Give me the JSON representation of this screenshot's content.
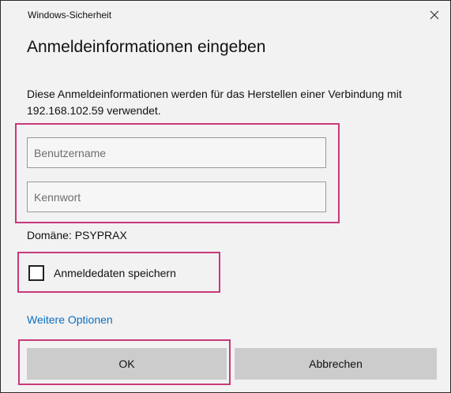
{
  "window": {
    "title": "Windows-Sicherheit"
  },
  "dialog": {
    "heading": "Anmeldeinformationen eingeben",
    "description": "Diese Anmeldeinformationen werden für das Herstellen einer Verbindung mit 192.168.102.59 verwendet.",
    "username": {
      "value": "",
      "placeholder": "Benutzername"
    },
    "password": {
      "value": "",
      "placeholder": "Kennwort"
    },
    "domain_text": "Domäne: PSYPRAX",
    "remember": {
      "label": "Anmeldedaten speichern",
      "checked": false
    },
    "more_options_link": "Weitere Optionen",
    "ok_label": "OK",
    "cancel_label": "Abbrechen"
  },
  "colors": {
    "highlight": "#c8397a",
    "link": "#0a6fc2",
    "button": "#cccccc",
    "background": "#f2f2f2"
  },
  "icons": {
    "close": "close-icon"
  }
}
